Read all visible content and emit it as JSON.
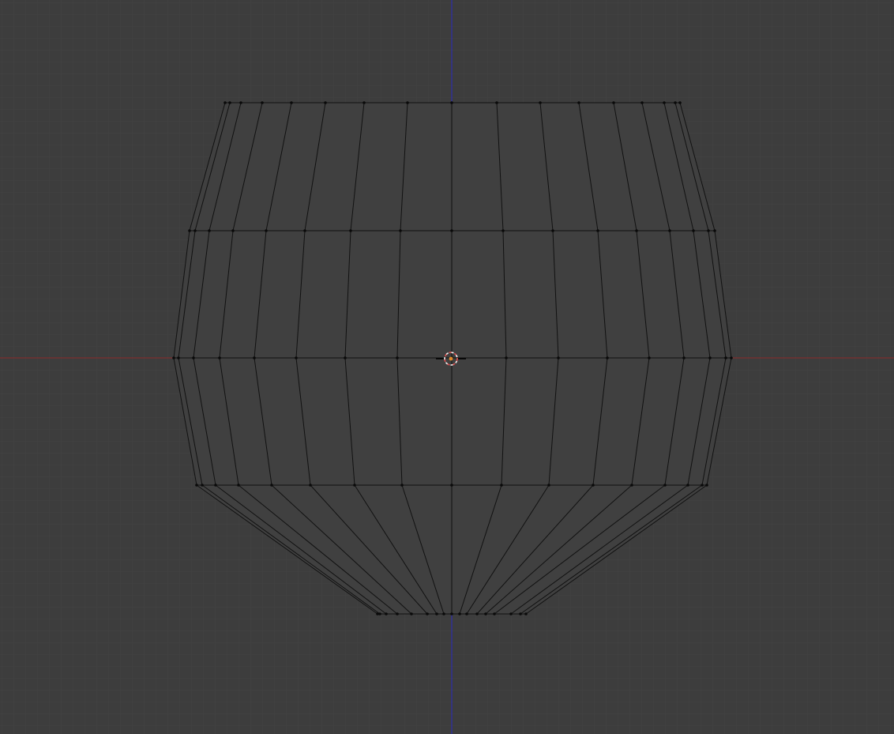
{
  "viewport": {
    "background_color": "#3d3d3d",
    "grid_color": "#444444",
    "x_axis_color": "#8a2b2b",
    "z_axis_color": "#2b2bbf",
    "mesh_face_color": "#404040",
    "mesh_edge_color": "#111111",
    "vertex_color": "#0a0a0a",
    "cursor_ring_colors": [
      "#e05050",
      "#f0f0f0"
    ],
    "origin_color": "#e08a2a"
  },
  "mesh": {
    "type": "vase",
    "rings": [
      [
        285,
        291,
        305,
        332,
        369,
        412,
        461,
        516,
        572,
        629,
        684,
        733,
        777,
        813,
        841,
        855,
        861
      ],
      [
        240,
        247,
        265,
        295,
        337,
        386,
        444,
        507,
        572,
        637,
        700,
        757,
        806,
        848,
        878,
        897,
        905
      ],
      [
        220,
        226,
        245,
        278,
        322,
        375,
        437,
        503,
        572,
        641,
        707,
        769,
        822,
        866,
        899,
        919,
        926
      ],
      [
        249,
        256,
        273,
        302,
        344,
        393,
        449,
        509,
        572,
        635,
        695,
        751,
        800,
        842,
        871,
        889,
        895
      ],
      [
        478,
        481,
        489,
        503,
        521,
        541,
        553,
        562,
        572,
        582,
        591,
        604,
        615,
        626,
        647,
        659,
        666
      ]
    ]
  }
}
